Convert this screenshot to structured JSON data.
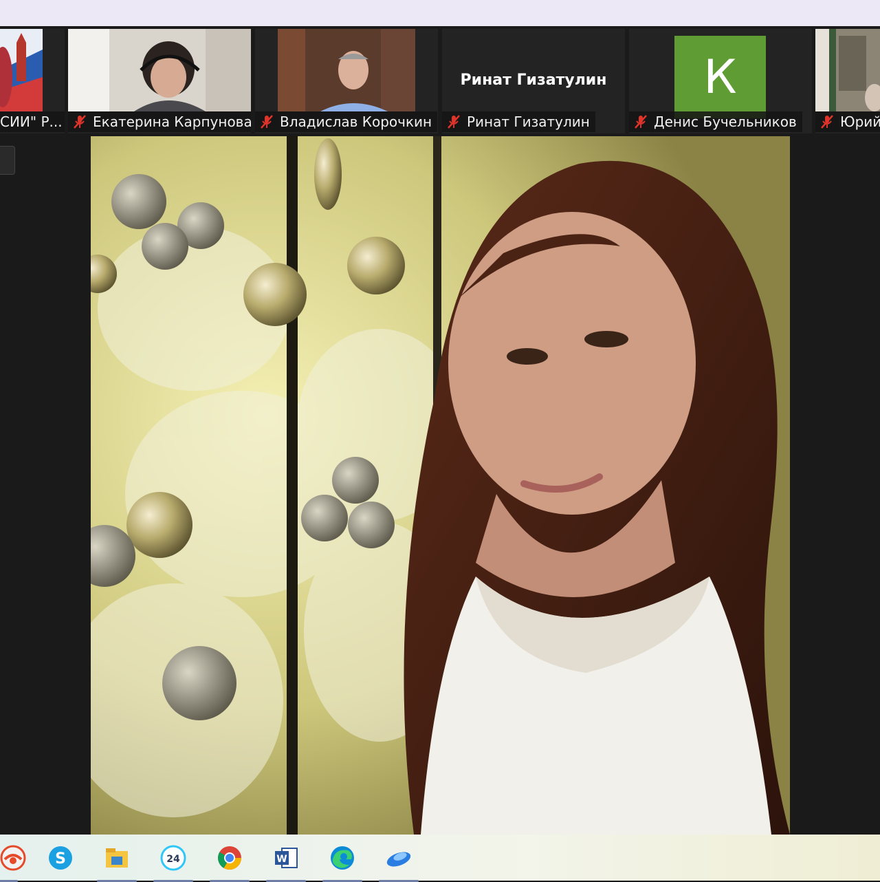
{
  "participants": [
    {
      "name": "\"РОССИИ\" Р...",
      "display": "СИИ\" Р...",
      "muted": true,
      "kind": "video-flag"
    },
    {
      "name": "Екатерина Карпунова",
      "muted": true,
      "kind": "video"
    },
    {
      "name": "Владислав Корочкин",
      "muted": true,
      "kind": "video"
    },
    {
      "name": "Ринат Гизатулин",
      "muted": true,
      "kind": "name-only",
      "center_text": "Ринат Гизатулин"
    },
    {
      "name": "Денис Бучельников",
      "muted": true,
      "kind": "avatar",
      "avatar_letter": "К"
    },
    {
      "name": "Юрий",
      "muted": true,
      "kind": "video"
    }
  ],
  "taskbar": {
    "apps": [
      {
        "name": "yandex-browser-icon"
      },
      {
        "name": "skype-icon"
      },
      {
        "name": "file-explorer-icon"
      },
      {
        "name": "bitrix24-icon"
      },
      {
        "name": "chrome-icon"
      },
      {
        "name": "word-icon"
      },
      {
        "name": "edge-icon"
      },
      {
        "name": "zoom-like-app-icon"
      }
    ]
  },
  "colors": {
    "top_bar": "#ece8f6",
    "avatar_bg": "#5f9d34",
    "muted_red": "#e0342b",
    "background": "#1a1a1a"
  }
}
